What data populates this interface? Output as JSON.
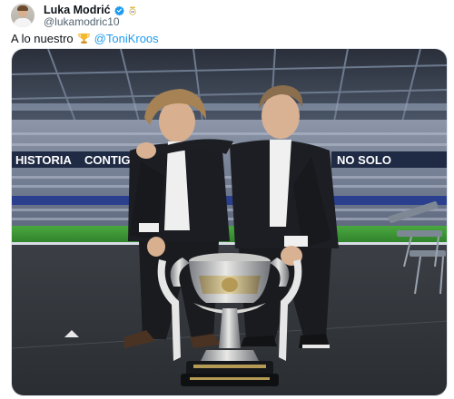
{
  "author": {
    "display_name": "Luka Modrić",
    "handle": "@lukamodric10",
    "verified": true,
    "avatar_icon": "avatar-photo",
    "affiliation_icon": "real-madrid-crest-icon"
  },
  "tweet": {
    "text": "A lo nuestro",
    "emoji_icon": "trophy-emoji",
    "mention": "@ToniKroos"
  },
  "media": {
    "type": "photo",
    "stadium_banners": [
      "HISTORIA",
      "CONTIG",
      "NO SOLO"
    ]
  },
  "colors": {
    "link": "#1d9bf0",
    "verified": "#1d9bf0",
    "text_secondary": "#536471",
    "pitch": "#3f9a3a"
  }
}
